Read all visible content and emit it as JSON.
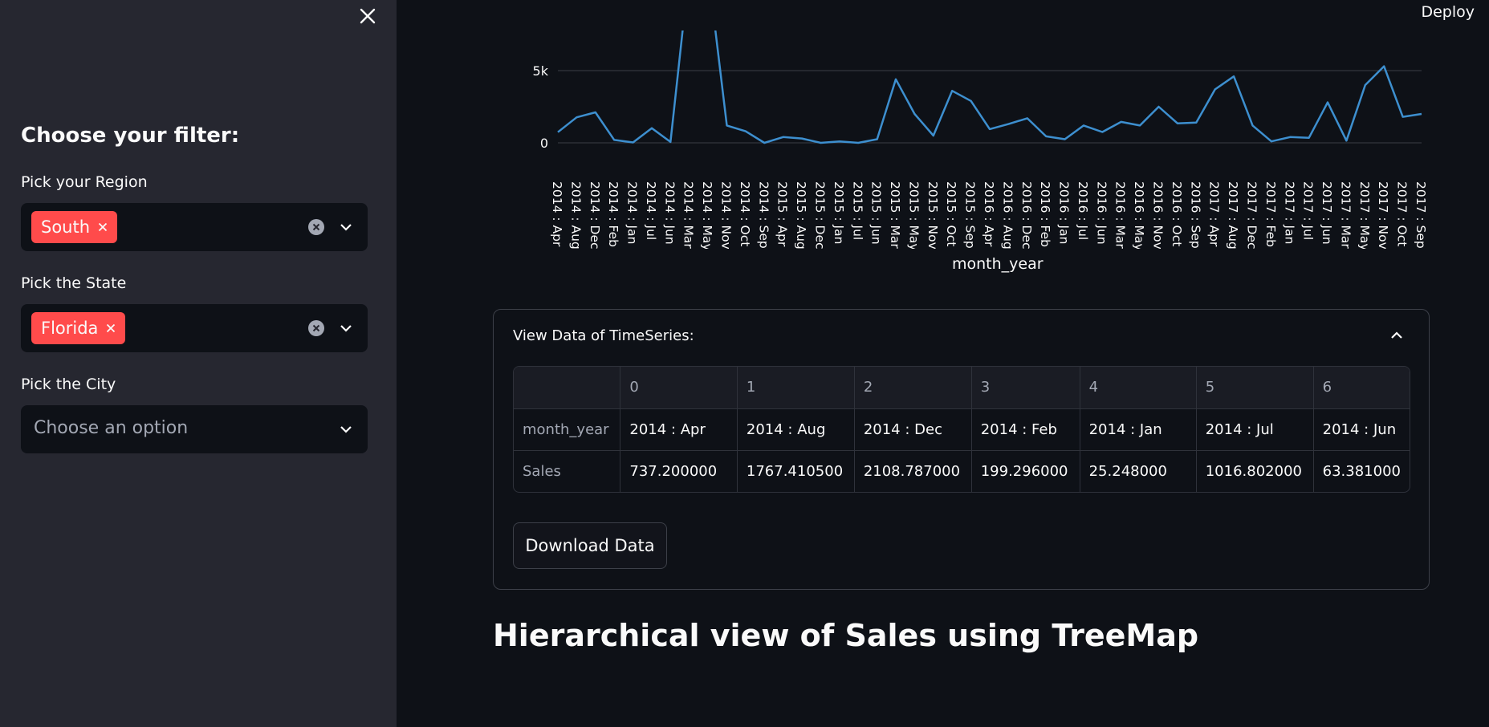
{
  "sidebar": {
    "heading": "Choose your filter:",
    "region": {
      "label": "Pick your Region",
      "selected": "South"
    },
    "state": {
      "label": "Pick the State",
      "selected": "Florida"
    },
    "city": {
      "label": "Pick the City",
      "placeholder": "Choose an option"
    }
  },
  "header": {
    "deploy_label": "Deploy"
  },
  "chart_data": {
    "type": "line",
    "xlabel": "month_year",
    "ylabel": "",
    "y_ticks": [
      "0",
      "5k"
    ],
    "ylim": [
      0,
      5000
    ],
    "color": "#3d8fcf",
    "categories": [
      "2014 : Apr",
      "2014 : Aug",
      "2014 : Dec",
      "2014 : Feb",
      "2014 : Jan",
      "2014 : Jul",
      "2014 : Jun",
      "2014 : Mar",
      "2014 : May",
      "2014 : Nov",
      "2014 : Oct",
      "2014 : Sep",
      "2015 : Apr",
      "2015 : Aug",
      "2015 : Dec",
      "2015 : Jan",
      "2015 : Jul",
      "2015 : Jun",
      "2015 : Mar",
      "2015 : May",
      "2015 : Nov",
      "2015 : Oct",
      "2015 : Sep",
      "2016 : Apr",
      "2016 : Aug",
      "2016 : Dec",
      "2016 : Feb",
      "2016 : Jan",
      "2016 : Jul",
      "2016 : Jun",
      "2016 : Mar",
      "2016 : May",
      "2016 : Nov",
      "2016 : Oct",
      "2016 : Sep",
      "2017 : Apr",
      "2017 : Aug",
      "2017 : Dec",
      "2017 : Feb",
      "2017 : Jan",
      "2017 : Jul",
      "2017 : Jun",
      "2017 : Mar",
      "2017 : May",
      "2017 : Nov",
      "2017 : Oct",
      "2017 : Sep"
    ],
    "values": [
      737.2,
      1767.4105,
      2108.787,
      199.296,
      25.248,
      1016.802,
      63.381,
      12000,
      12000,
      1200,
      800,
      0,
      400,
      300,
      0,
      100,
      0,
      250,
      4400,
      2000,
      500,
      3600,
      2900,
      950,
      1300,
      1700,
      450,
      250,
      1200,
      750,
      1450,
      1200,
      2500,
      1350,
      1400,
      3700,
      4600,
      1200,
      100,
      400,
      350,
      2800,
      150,
      4000,
      5300,
      1800,
      2000
    ]
  },
  "expander": {
    "title": "View Data of TimeSeries:",
    "columns": [
      "",
      "0",
      "1",
      "2",
      "3",
      "4",
      "5",
      "6"
    ],
    "rows": [
      [
        "month_year",
        "2014 : Apr",
        "2014 : Aug",
        "2014 : Dec",
        "2014 : Feb",
        "2014 : Jan",
        "2014 : Jul",
        "2014 : Jun"
      ],
      [
        "Sales",
        "737.200000",
        "1767.410500",
        "2108.787000",
        "199.296000",
        "25.248000",
        "1016.802000",
        "63.381000"
      ]
    ],
    "download_label": "Download Data"
  },
  "treemap": {
    "title": "Hierarchical view of Sales using TreeMap"
  }
}
